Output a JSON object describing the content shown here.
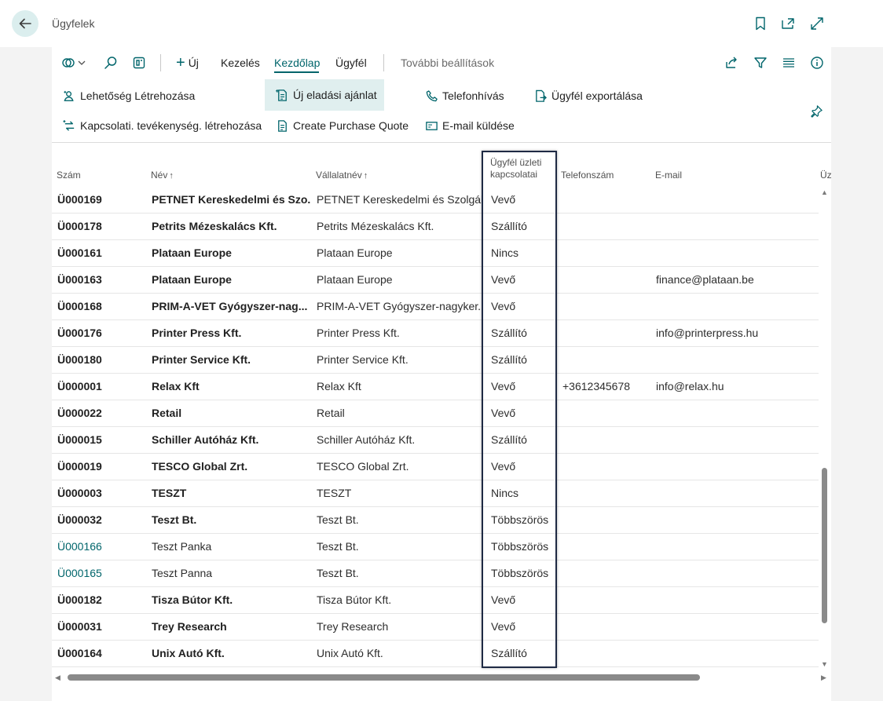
{
  "window": {
    "title": "Ügyfelek"
  },
  "actionbar": {
    "new_label": "Új",
    "manage_label": "Kezelés",
    "home_label": "Kezdőlap",
    "customer_label": "Ügyfél",
    "more_label": "További beállítások"
  },
  "promoted": {
    "create_opportunity": "Lehetőség Létrehozása",
    "new_sales_quote": "Új eladási ajánlat",
    "phone_call": "Telefonhívás",
    "export_customer": "Ügyfél exportálása",
    "create_interaction": "Kapcsolati. tevékenység. létrehozása",
    "create_purchase_quote": "Create Purchase Quote",
    "send_email": "E-mail küldése"
  },
  "table": {
    "headers": {
      "number": "Szám",
      "name": "Név",
      "company": "Vállalatnév",
      "relation_line1": "Ügyfél üzleti",
      "relation_line2": "kapcsolatai",
      "phone": "Telefonszám",
      "email": "E-mail",
      "truncated": "Üz"
    },
    "sort_arrow": "↑",
    "rows": [
      {
        "no": "Ü000169",
        "name": "PETNET Kereskedelmi és Szo...",
        "company": "PETNET Kereskedelmi és Szolgált...",
        "relation": "Vevő",
        "phone": "",
        "email": ""
      },
      {
        "no": "Ü000178",
        "name": "Petrits Mézeskalács Kft.",
        "company": "Petrits Mézeskalács Kft.",
        "relation": "Szállító",
        "phone": "",
        "email": ""
      },
      {
        "no": "Ü000161",
        "name": "Plataan Europe",
        "company": "Plataan Europe",
        "relation": "Nincs",
        "phone": "",
        "email": ""
      },
      {
        "no": "Ü000163",
        "name": "Plataan Europe",
        "company": "Plataan Europe",
        "relation": "Vevő",
        "phone": "",
        "email": "finance@plataan.be"
      },
      {
        "no": "Ü000168",
        "name": "PRIM-A-VET Gyógyszer-nag...",
        "company": "PRIM-A-VET Gyógyszer-nagyker...",
        "relation": "Vevő",
        "phone": "",
        "email": ""
      },
      {
        "no": "Ü000176",
        "name": "Printer Press Kft.",
        "company": "Printer Press Kft.",
        "relation": "Szállító",
        "phone": "",
        "email": "info@printerpress.hu"
      },
      {
        "no": "Ü000180",
        "name": "Printer Service Kft.",
        "company": "Printer Service Kft.",
        "relation": "Szállító",
        "phone": "",
        "email": ""
      },
      {
        "no": "Ü000001",
        "name": "Relax Kft",
        "company": "Relax Kft",
        "relation": "Vevő",
        "phone": "+3612345678",
        "email": "info@relax.hu"
      },
      {
        "no": "Ü000022",
        "name": "Retail",
        "company": "Retail",
        "relation": "Vevő",
        "phone": "",
        "email": ""
      },
      {
        "no": "Ü000015",
        "name": "Schiller Autóház Kft.",
        "company": "Schiller Autóház Kft.",
        "relation": "Szállító",
        "phone": "",
        "email": ""
      },
      {
        "no": "Ü000019",
        "name": "TESCO Global Zrt.",
        "company": "TESCO Global Zrt.",
        "relation": "Vevő",
        "phone": "",
        "email": ""
      },
      {
        "no": "Ü000003",
        "name": "TESZT",
        "company": "TESZT",
        "relation": "Nincs",
        "phone": "",
        "email": ""
      },
      {
        "no": "Ü000032",
        "name": "Teszt Bt.",
        "company": "Teszt Bt.",
        "relation": "Többszörös",
        "phone": "",
        "email": ""
      },
      {
        "no": "Ü000166",
        "name": "Teszt Panka",
        "company": "Teszt Bt.",
        "relation": "Többszörös",
        "phone": "",
        "email": ""
      },
      {
        "no": "Ü000165",
        "name": "Teszt Panna",
        "company": "Teszt Bt.",
        "relation": "Többszörös",
        "phone": "",
        "email": ""
      },
      {
        "no": "Ü000182",
        "name": "Tisza Bútor Kft.",
        "company": "Tisza Bútor Kft.",
        "relation": "Vevő",
        "phone": "",
        "email": ""
      },
      {
        "no": "Ü000031",
        "name": "Trey Research",
        "company": "Trey Research",
        "relation": "Vevő",
        "phone": "",
        "email": ""
      },
      {
        "no": "Ü000164",
        "name": "Unix Autó Kft.",
        "company": "Unix Autó Kft.",
        "relation": "Szállító",
        "phone": "",
        "email": ""
      }
    ]
  },
  "colors": {
    "accent": "#00656b",
    "highlight_border": "#1f2a44"
  }
}
